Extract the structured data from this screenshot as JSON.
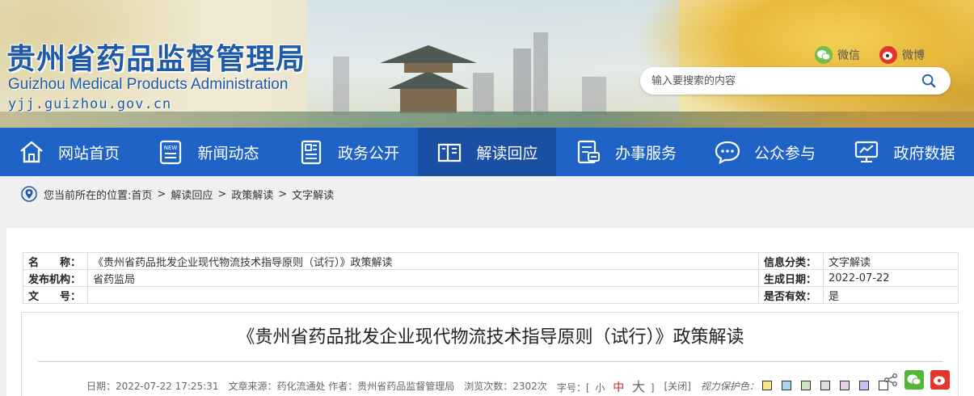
{
  "header": {
    "title_cn": "贵州省药品监督管理局",
    "title_en": "Guizhou Medical Products Administration",
    "domain": "yjj.guizhou.gov.cn",
    "wechat_label": "微信",
    "weibo_label": "微博",
    "search_placeholder": "输入要搜索的内容"
  },
  "nav": {
    "items": [
      {
        "label": "网站首页",
        "icon": "home-icon"
      },
      {
        "label": "新闻动态",
        "icon": "news-icon"
      },
      {
        "label": "政务公开",
        "icon": "open-gov-icon"
      },
      {
        "label": "解读回应",
        "icon": "book-icon",
        "active": true
      },
      {
        "label": "办事服务",
        "icon": "service-icon"
      },
      {
        "label": "公众参与",
        "icon": "chat-icon"
      },
      {
        "label": "政府数据",
        "icon": "data-icon"
      }
    ]
  },
  "breadcrumb": {
    "prefix": "您当前所在的位置:",
    "items": [
      "首页",
      "解读回应",
      "政策解读",
      "文字解读"
    ],
    "separator": ">"
  },
  "meta": {
    "name_label": "名　　称：",
    "name_value": "《贵州省药品批发企业现代物流技术指导原则（试行）》政策解读",
    "org_label": "发布机构：",
    "org_value": "省药监局",
    "doc_label": "文　　号：",
    "doc_value": "",
    "category_label": "信息分类：",
    "category_value": "文字解读",
    "date_label": "生成日期：",
    "date_value": "2022-07-22",
    "valid_label": "是否有效：",
    "valid_value": "是"
  },
  "article": {
    "title": "《贵州省药品批发企业现代物流技术指导原则（试行）》政策解读",
    "date": "日期：2022-07-22 17:25:31",
    "source": "文章来源：药化流通处 作者：贵州省药品监督管理局",
    "views": "浏览次数：2302次",
    "font_size_prefix": "字号：[",
    "font_small": "小",
    "font_medium": "中",
    "font_large": "大",
    "font_size_suffix": "]",
    "close": "[关闭]",
    "eye_protection": "视力保护色：",
    "swatch_colors": [
      "#f7e58a",
      "#a8d8f0",
      "#c8e6c0",
      "#dddddd",
      "#e8d0e8",
      "#c8c0f0",
      "#ffffff"
    ]
  },
  "colors": {
    "nav_bg": "#1f63c6",
    "nav_active": "#1a4fa3",
    "brand_blue": "#1f5aa8",
    "font_medium_red": "#d02020"
  }
}
